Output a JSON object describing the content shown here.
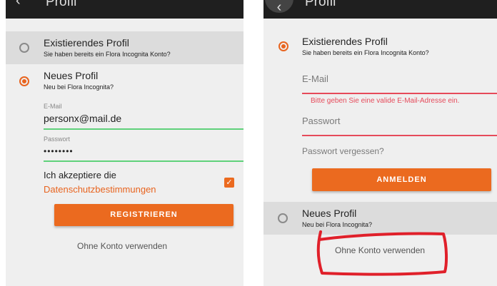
{
  "left": {
    "appbar": {
      "back_icon": "arrow-left-icon",
      "back_glyph": "‹",
      "title": "Profil"
    },
    "existing": {
      "title": "Existierendes Profil",
      "subtitle": "Sie haben bereits ein Flora Incognita Konto?",
      "selected": false
    },
    "new_profile": {
      "title": "Neues Profil",
      "subtitle": "Neu bei Flora Incognita?",
      "selected": true
    },
    "email": {
      "label": "E-Mail",
      "value": "personx@mail.de"
    },
    "password": {
      "label": "Passwort",
      "value": "••••••••"
    },
    "consent": {
      "text": "Ich akzeptiere die",
      "link": "Datenschutzbestimmungen",
      "checked": true,
      "check_glyph": "✓"
    },
    "register_button": "REGISTRIEREN",
    "no_account": "Ohne Konto verwenden"
  },
  "right": {
    "appbar": {
      "back_icon": "arrow-left-icon",
      "back_glyph": "‹",
      "title": "Profil"
    },
    "existing": {
      "title": "Existierendes Profil",
      "subtitle": "Sie haben bereits ein Flora Incognita Konto?",
      "selected": true
    },
    "email_placeholder": "E-Mail",
    "email_error": "Bitte geben Sie eine valide E-Mail-Adresse ein.",
    "password_placeholder": "Passwort",
    "forgot_password": "Passwort vergessen?",
    "login_button": "ANMELDEN",
    "new_profile": {
      "title": "Neues Profil",
      "subtitle": "Neu bei Flora Incognita?",
      "selected": false
    },
    "no_account": "Ohne Konto verwenden"
  },
  "colors": {
    "accent": "#eb6a1f",
    "error": "#e64a5a",
    "valid": "#5fd17a",
    "annotation": "#e0202a"
  }
}
